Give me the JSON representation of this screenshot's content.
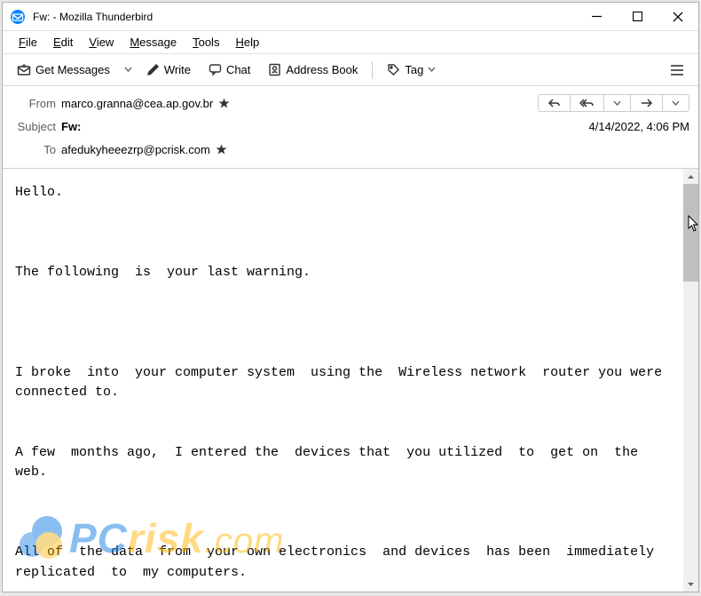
{
  "window": {
    "title": "Fw: - Mozilla Thunderbird"
  },
  "menu": {
    "file": "File",
    "edit": "Edit",
    "view": "View",
    "message": "Message",
    "tools": "Tools",
    "help": "Help"
  },
  "toolbar": {
    "get_messages": "Get Messages",
    "write": "Write",
    "chat": "Chat",
    "address_book": "Address Book",
    "tag": "Tag"
  },
  "headers": {
    "from_label": "From",
    "from_value": "marco.granna@cea.ap.gov.br",
    "subject_label": "Subject",
    "subject_value": "Fw:",
    "to_label": "To",
    "to_value": "afedukyheeezrp@pcrisk.com",
    "date": "4/14/2022, 4:06 PM"
  },
  "body": "Hello.\n\n\n\nThe following  is  your last warning.\n\n\n\n\nI broke  into  your computer system  using the  Wireless network  router you were connected to.\n\n\nA few  months ago,  I entered the  devices that  you utilized  to  get on  the web.\n\n\n\nAll of  the data  from  your own electronics  and devices  has been  immediately replicated  to  my computers.",
  "watermark": {
    "pc": "PC",
    "risk": "risk",
    "com": ".com"
  }
}
